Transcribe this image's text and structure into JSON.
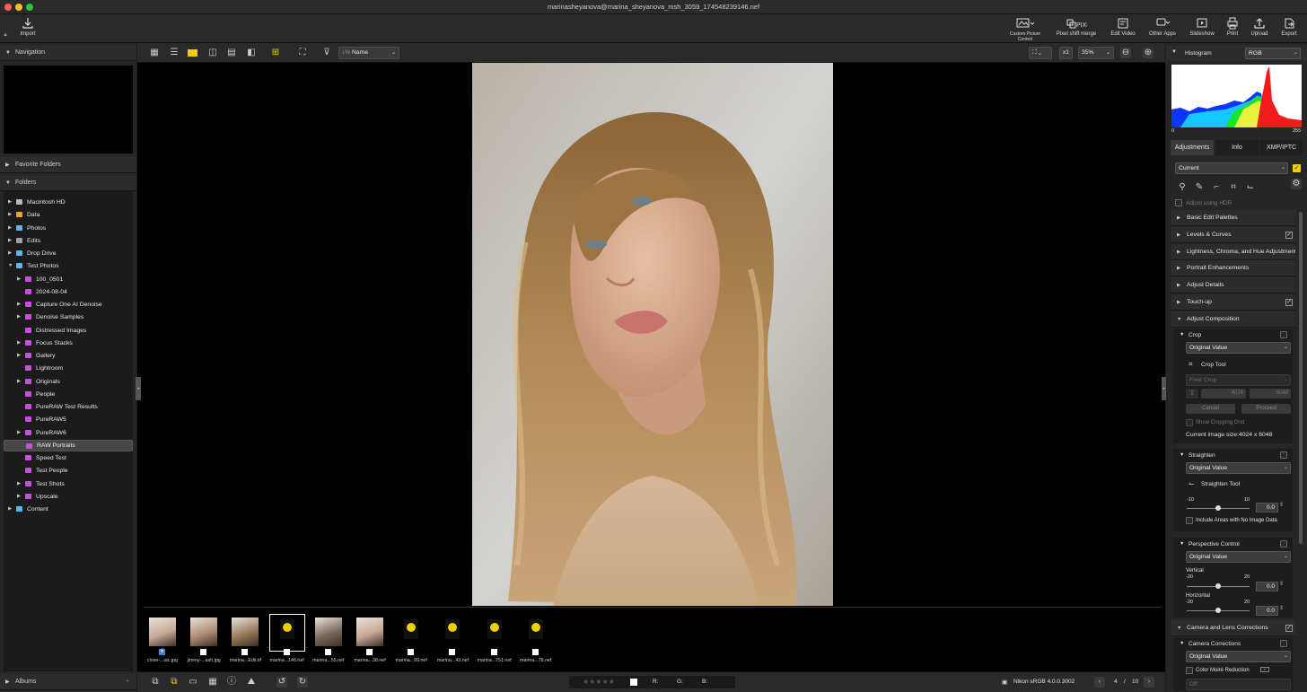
{
  "window": {
    "title": "marinasheyanova@marina_sheyanova_msh_3059_174548239146.nef"
  },
  "toolbar": {
    "import": "Import",
    "custom_picture_control": "Custom Picture Control",
    "pixel_shift_merge": "Pixel shift merge",
    "edit_video": "Edit Video",
    "other_apps": "Other Apps",
    "slideshow": "Slideshow",
    "print": "Print",
    "upload": "Upload",
    "export": "Export"
  },
  "left_panel": {
    "navigation": "Navigation",
    "favorite_folders": "Favorite Folders",
    "folders": "Folders",
    "albums": "Albums",
    "folder_items": [
      {
        "label": "Macintosh HD",
        "depth": 0,
        "twisty": "▶",
        "color": "#b8b8b8",
        "selected": false
      },
      {
        "label": "Data",
        "depth": 0,
        "twisty": "▶",
        "color": "#e8a32c",
        "selected": false
      },
      {
        "label": "Photos",
        "depth": 0,
        "twisty": "▶",
        "color": "#5fb6e8",
        "selected": false
      },
      {
        "label": "Edits",
        "depth": 0,
        "twisty": "▶",
        "color": "#a0a0a0",
        "selected": false
      },
      {
        "label": "Drop Drive",
        "depth": 0,
        "twisty": "▶",
        "color": "#5fb6e8",
        "selected": false
      },
      {
        "label": "Test Photos",
        "depth": 0,
        "twisty": "▼",
        "color": "#5fb6e8",
        "selected": false
      },
      {
        "label": "100_0501",
        "depth": 1,
        "twisty": "▶",
        "color": "#c94fe0",
        "selected": false
      },
      {
        "label": "2024-08-04",
        "depth": 1,
        "twisty": "",
        "color": "#c94fe0",
        "selected": false
      },
      {
        "label": "Capture One AI Denoise",
        "depth": 1,
        "twisty": "▶",
        "color": "#c94fe0",
        "selected": false
      },
      {
        "label": "Denoise Samples",
        "depth": 1,
        "twisty": "▶",
        "color": "#c94fe0",
        "selected": false
      },
      {
        "label": "Distressed Images",
        "depth": 1,
        "twisty": "",
        "color": "#c94fe0",
        "selected": false
      },
      {
        "label": "Focus Stacks",
        "depth": 1,
        "twisty": "▶",
        "color": "#c94fe0",
        "selected": false
      },
      {
        "label": "Gallery",
        "depth": 1,
        "twisty": "▶",
        "color": "#c94fe0",
        "selected": false
      },
      {
        "label": "Lightroom",
        "depth": 1,
        "twisty": "",
        "color": "#c94fe0",
        "selected": false
      },
      {
        "label": "Originals",
        "depth": 1,
        "twisty": "▶",
        "color": "#c94fe0",
        "selected": false
      },
      {
        "label": "People",
        "depth": 1,
        "twisty": "",
        "color": "#c94fe0",
        "selected": false
      },
      {
        "label": "PureRAW Test Results",
        "depth": 1,
        "twisty": "",
        "color": "#c94fe0",
        "selected": false
      },
      {
        "label": "PureRAW5",
        "depth": 1,
        "twisty": "",
        "color": "#c94fe0",
        "selected": false
      },
      {
        "label": "PureRAW6",
        "depth": 1,
        "twisty": "▶",
        "color": "#c94fe0",
        "selected": false
      },
      {
        "label": "RAW Portraits",
        "depth": 1,
        "twisty": "",
        "color": "#c94fe0",
        "selected": true
      },
      {
        "label": "Speed Test",
        "depth": 1,
        "twisty": "",
        "color": "#c94fe0",
        "selected": false
      },
      {
        "label": "Test People",
        "depth": 1,
        "twisty": "",
        "color": "#c94fe0",
        "selected": false
      },
      {
        "label": "Test Shots",
        "depth": 1,
        "twisty": "▶",
        "color": "#c94fe0",
        "selected": false
      },
      {
        "label": "Upscale",
        "depth": 1,
        "twisty": "▶",
        "color": "#c94fe0",
        "selected": false
      },
      {
        "label": "Content",
        "depth": 0,
        "twisty": "▶",
        "color": "#5fb6e8",
        "selected": false
      }
    ]
  },
  "viewer_toolbar": {
    "sort_label": "Name",
    "zoom_multiplier": "x1",
    "zoom_level": "35%"
  },
  "filmstrip": [
    {
      "caption": "close-...utc.jpg",
      "kind": "photo",
      "badge": "6",
      "selected": false
    },
    {
      "caption": "jimmy-...ash.jpg",
      "kind": "photo",
      "badge": "",
      "selected": false
    },
    {
      "caption": "marina...Edit.tif",
      "kind": "photo",
      "badge": "",
      "selected": false
    },
    {
      "caption": "marina...146.nef",
      "kind": "raw",
      "badge": "",
      "selected": true
    },
    {
      "caption": "marina...55.nef",
      "kind": "photo",
      "badge": "",
      "selected": false
    },
    {
      "caption": "marina...38.nef",
      "kind": "photo",
      "badge": "",
      "selected": false
    },
    {
      "caption": "marina...99.nef",
      "kind": "raw",
      "badge": "",
      "selected": false
    },
    {
      "caption": "marina...43.nef",
      "kind": "raw",
      "badge": "",
      "selected": false
    },
    {
      "caption": "marina...751.nef",
      "kind": "raw",
      "badge": "",
      "selected": false
    },
    {
      "caption": "marina...78.nef",
      "kind": "raw",
      "badge": "",
      "selected": false
    }
  ],
  "status": {
    "rgb_r": "R:",
    "rgb_g": "G:",
    "rgb_b": "B:",
    "color_profile": "Nikon sRGB 4.0.0.3002",
    "page_current": "4",
    "page_sep": "/",
    "page_total": "10",
    "rating_stars": "★★★★★"
  },
  "right_panel": {
    "histogram": "Histogram",
    "histogram_channel": "RGB",
    "hist_min": "0",
    "hist_max": "255",
    "tabs": [
      "Adjustments",
      "Info",
      "XMP/IPTC"
    ],
    "preset": "Current",
    "adjust_hdr": "Adjust using HDR",
    "palettes": [
      "Basic Edit Palettes",
      "Levels & Curves",
      "Lightness, Chroma, and Hue Adjustment",
      "Portrait Enhancements",
      "Adjust Details",
      "Touch-up",
      "Adjust Composition"
    ],
    "crop": {
      "title": "Crop",
      "value": "Original Value",
      "tool": "Crop Tool",
      "mode": "Free Crop",
      "w": "4024",
      "sep": ":",
      "h": "6048",
      "cancel": "Cancel",
      "proceed": "Proceed",
      "grid": "Show Cropping Grid",
      "size": "Current image size:4024 x 6048"
    },
    "straighten": {
      "title": "Straighten",
      "value": "Original Value",
      "tool": "Straighten Tool",
      "min": "-10",
      "max": "10",
      "num": "0.0",
      "include": "Include Areas with No Image Data"
    },
    "perspective": {
      "title": "Perspective Control",
      "value": "Original Value",
      "vertical": "Vertical",
      "horizontal": "Horizontal",
      "min": "-20",
      "max": "20",
      "v_num": "0.0",
      "h_num": "0.0"
    },
    "camera_lens": "Camera and Lens Corrections",
    "camera_corrections": "Camera Corrections",
    "cc_value": "Original Value",
    "moire": "Color Moiré Reduction",
    "moire_value": "Off"
  }
}
